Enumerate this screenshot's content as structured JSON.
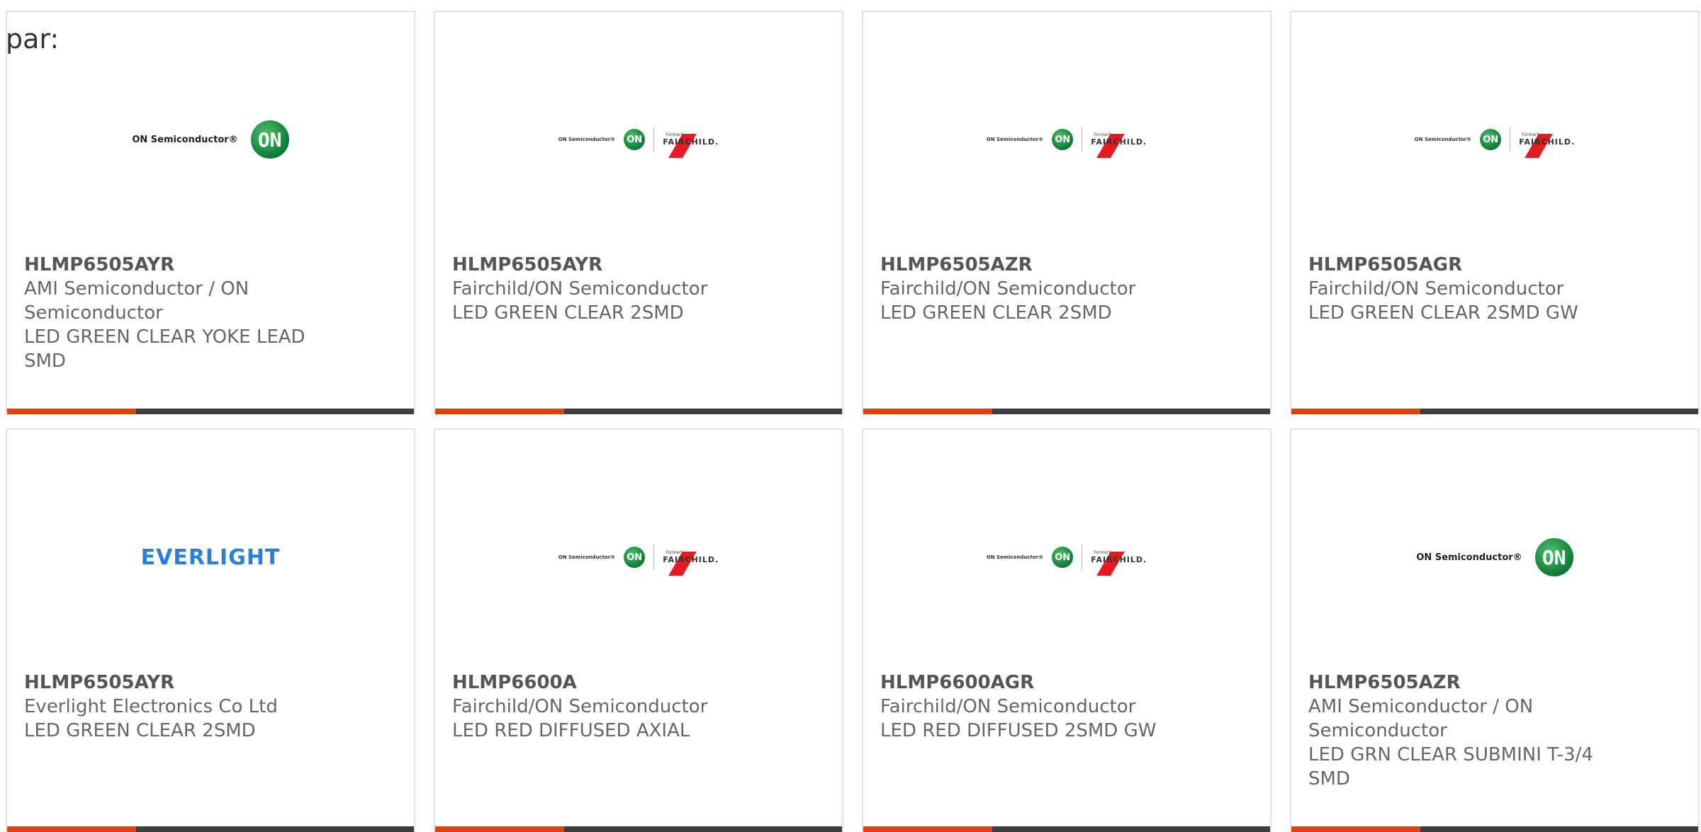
{
  "header": {
    "par_label": "par:"
  },
  "cards": [
    {
      "logo": "on-semiconductor",
      "logo_text": "ON Semiconductor®",
      "logo_mark": "ON",
      "part_number": "HLMP6505AYR",
      "manufacturer": "AMI Semiconductor / ON Semiconductor",
      "description": "LED GREEN CLEAR YOKE LEAD SMD"
    },
    {
      "logo": "fairchild-on",
      "logo_text": "ON Semiconductor®",
      "logo_mark": "ON",
      "logo_formerly": "Formerly",
      "logo_brand": "FAIRCHILD.",
      "part_number": "HLMP6505AYR",
      "manufacturer": "Fairchild/ON Semiconductor",
      "description": "LED GREEN CLEAR 2SMD"
    },
    {
      "logo": "fairchild-on",
      "logo_text": "ON Semiconductor®",
      "logo_mark": "ON",
      "logo_formerly": "Formerly",
      "logo_brand": "FAIRCHILD.",
      "part_number": "HLMP6505AZR",
      "manufacturer": "Fairchild/ON Semiconductor",
      "description": "LED GREEN CLEAR 2SMD"
    },
    {
      "logo": "fairchild-on",
      "logo_text": "ON Semiconductor®",
      "logo_mark": "ON",
      "logo_formerly": "Formerly",
      "logo_brand": "FAIRCHILD.",
      "part_number": "HLMP6505AGR",
      "manufacturer": "Fairchild/ON Semiconductor",
      "description": "LED GREEN CLEAR 2SMD GW"
    },
    {
      "logo": "everlight",
      "logo_text": "EVERLIGHT",
      "part_number": "HLMP6505AYR",
      "manufacturer": "Everlight Electronics Co Ltd",
      "description": "LED GREEN CLEAR 2SMD"
    },
    {
      "logo": "fairchild-on",
      "logo_text": "ON Semiconductor®",
      "logo_mark": "ON",
      "logo_formerly": "Formerly",
      "logo_brand": "FAIRCHILD.",
      "part_number": "HLMP6600A",
      "manufacturer": "Fairchild/ON Semiconductor",
      "description": "LED RED DIFFUSED AXIAL"
    },
    {
      "logo": "fairchild-on",
      "logo_text": "ON Semiconductor®",
      "logo_mark": "ON",
      "logo_formerly": "Formerly",
      "logo_brand": "FAIRCHILD.",
      "part_number": "HLMP6600AGR",
      "manufacturer": "Fairchild/ON Semiconductor",
      "description": "LED RED DIFFUSED 2SMD GW"
    },
    {
      "logo": "on-semiconductor",
      "logo_text": "ON Semiconductor®",
      "logo_mark": "ON",
      "part_number": "HLMP6505AZR",
      "manufacturer": "AMI Semiconductor / ON Semiconductor",
      "description": "LED GRN CLEAR SUBMINI T-3/4 SMD"
    }
  ],
  "colors": {
    "accent": "#e3400f",
    "bar": "#3d3d3d",
    "text": "#666666",
    "on_green": "#0b7a36",
    "fairchild_red": "#e41b23",
    "everlight_blue": "#2a7fd9"
  }
}
